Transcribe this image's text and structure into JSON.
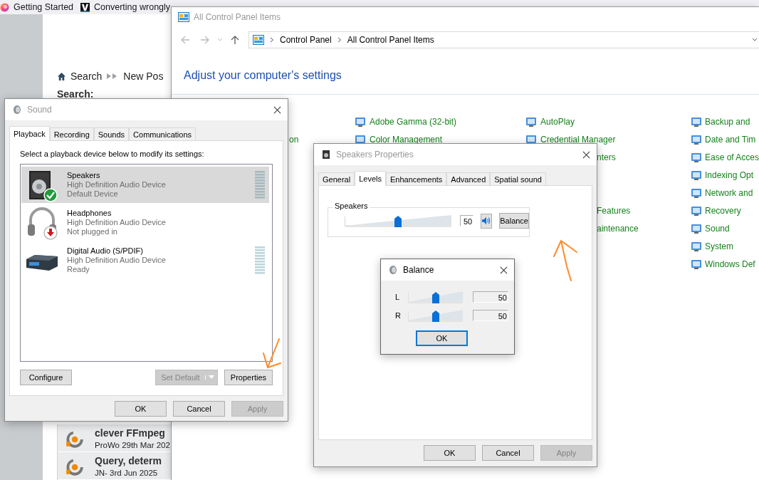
{
  "browser": {
    "tabs": [
      {
        "title": "Getting Started"
      },
      {
        "title": "Converting wrongly"
      }
    ]
  },
  "forum": {
    "breadcrumb": [
      {
        "label": "Search"
      },
      {
        "label": "New Pos"
      }
    ],
    "search_label": "Search:",
    "topics": [
      {
        "title": "clever FFmpeg",
        "meta": "ProWo 29th Mar 202"
      },
      {
        "title": "Query, determ",
        "meta": "JN- 3rd Jun 2025"
      }
    ]
  },
  "control_panel": {
    "title": "All Control Panel Items",
    "active": false,
    "address": [
      "Control Panel",
      "All Control Panel Items"
    ],
    "heading": "Adjust your computer's settings",
    "columns": [
      {
        "items": [
          {
            "label": "on",
            "kind": "partial"
          }
        ]
      },
      {
        "items": [
          {
            "label": "Adobe Gamma (32-bit)",
            "kind": "item"
          },
          {
            "label": "Color Management",
            "kind": "item"
          }
        ]
      },
      {
        "items": [
          {
            "label": "AutoPlay",
            "kind": "item"
          },
          {
            "label": "Credential Manager",
            "kind": "item"
          },
          {
            "label": "nters",
            "kind": "partial"
          },
          {
            "label": "Features",
            "kind": "partial"
          },
          {
            "label": "aintenance",
            "kind": "partial"
          }
        ]
      },
      {
        "items": [
          {
            "label": "Backup and",
            "kind": "item"
          },
          {
            "label": "Date and Tim",
            "kind": "item"
          },
          {
            "label": "Ease of Acces",
            "kind": "item"
          },
          {
            "label": "Indexing Opt",
            "kind": "item"
          },
          {
            "label": "Network and",
            "kind": "item"
          },
          {
            "label": "Recovery",
            "kind": "item"
          },
          {
            "label": "Sound",
            "kind": "item"
          },
          {
            "label": "System",
            "kind": "item"
          },
          {
            "label": "Windows Def",
            "kind": "item"
          }
        ]
      }
    ]
  },
  "sound": {
    "title": "Sound",
    "active": false,
    "tabs": [
      {
        "label": "Playback",
        "selected": true
      },
      {
        "label": "Recording",
        "selected": false
      },
      {
        "label": "Sounds",
        "selected": false
      },
      {
        "label": "Communications",
        "selected": false
      }
    ],
    "instruction": "Select a playback device below to modify its settings:",
    "devices": [
      {
        "kind": "speakers",
        "name": "Speakers",
        "driver": "High Definition Audio Device",
        "status": "Default Device",
        "is_default": true,
        "plugged_in": true,
        "meter": true,
        "selected": true
      },
      {
        "kind": "headphones",
        "name": "Headphones",
        "driver": "High Definition Audio Device",
        "status": "Not plugged in",
        "is_default": false,
        "plugged_in": false,
        "meter": false,
        "selected": false
      },
      {
        "kind": "digital",
        "name": "Digital Audio (S/PDIF)",
        "driver": "High Definition Audio Device",
        "status": "Ready",
        "is_default": false,
        "plugged_in": true,
        "meter": true,
        "selected": false
      }
    ],
    "buttons": [
      {
        "label": "Configure",
        "kind": "plain",
        "disabled": false
      },
      {
        "label": "Set Default",
        "kind": "split",
        "disabled": true
      },
      {
        "label": "Properties",
        "kind": "plain",
        "disabled": false
      }
    ],
    "footer": [
      {
        "label": "OK",
        "disabled": false
      },
      {
        "label": "Cancel",
        "disabled": false
      },
      {
        "label": "Apply",
        "disabled": true
      }
    ]
  },
  "speakers_properties": {
    "title": "Speakers Properties",
    "active": false,
    "tabs": [
      {
        "label": "General",
        "selected": false
      },
      {
        "label": "Levels",
        "selected": true
      },
      {
        "label": "Enhancements",
        "selected": false
      },
      {
        "label": "Advanced",
        "selected": false
      },
      {
        "label": "Spatial sound",
        "selected": false
      }
    ],
    "group": "Speakers",
    "level": 0.5,
    "value": "50",
    "muted": false,
    "balance_button": "Balance",
    "footer": [
      {
        "label": "OK",
        "disabled": false
      },
      {
        "label": "Cancel",
        "disabled": false
      },
      {
        "label": "Apply",
        "disabled": true
      }
    ]
  },
  "balance": {
    "title": "Balance",
    "active": true,
    "channels": [
      {
        "label": "L",
        "level": 0.5,
        "value": "50"
      },
      {
        "label": "R",
        "level": 0.5,
        "value": "50"
      }
    ],
    "ok": {
      "label": "OK",
      "focused": true
    }
  }
}
